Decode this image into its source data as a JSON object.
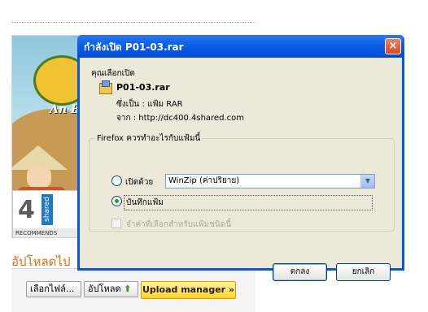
{
  "background": {
    "banner_text": "An E",
    "recommends_number": "4",
    "recommends_brand": "shared",
    "recommends_label": "RECOMMENDS",
    "upload_title": "อัปโหลดไป",
    "choose_file_button": "เลือกไฟล์...",
    "upload_button": "อัปโหลด",
    "upload_manager_button": "Upload manager »"
  },
  "dialog": {
    "title": "กำลังเปิด P01-03.rar",
    "close_symbol": "×",
    "you_chose_label": "คุณเลือกเปิด",
    "file_name": "P01-03.rar",
    "type_row": "ซึ่งเป็น :  แฟ้ม RAR",
    "from_row": "จาก :  http://dc400.4shared.com",
    "question": "Firefox ควรทำอะไรกับแฟ้มนี้",
    "open_with_label": "เปิดด้วย",
    "open_with_value": "WinZip (ค่าปริยาย)",
    "save_file_label": "บันทึกแฟ้ม",
    "selected_option": "save",
    "remember_label": "จำค่าที่เลือกสำหรับแฟ้มชนิดนี้",
    "ok_button": "ตกลง",
    "cancel_button": "ยกเลิก"
  },
  "colors": {
    "titlebar": "#0a5fe8",
    "dialog_face": "#ece9d8",
    "upload_title": "#e06c0e",
    "manager_button": "#ffd42a"
  }
}
